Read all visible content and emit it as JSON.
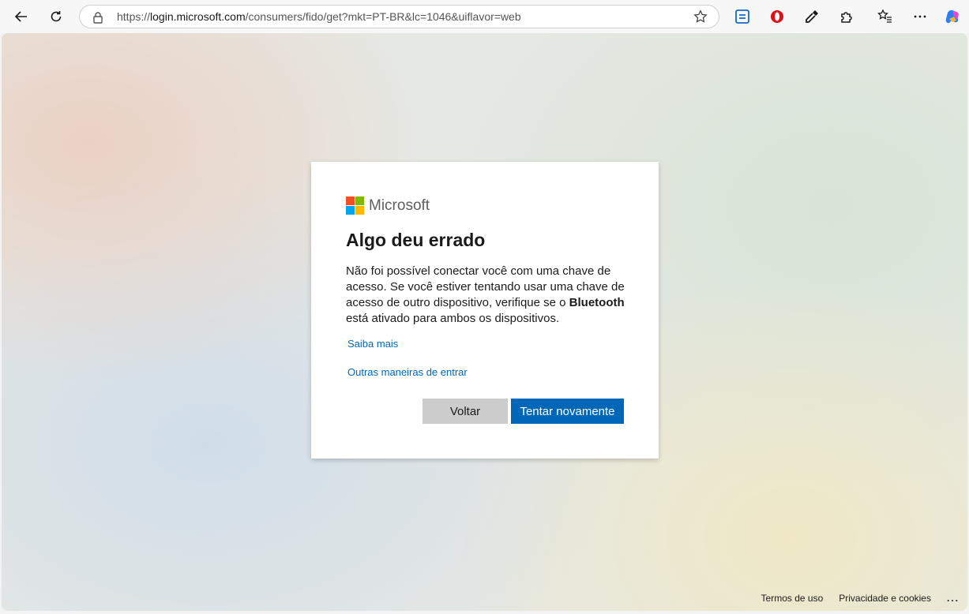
{
  "browser": {
    "url_prefix": "https://",
    "url_host": "login.microsoft.com",
    "url_path": "/consumers/fido/get?mkt=PT-BR&lc=1046&uiflavor=web"
  },
  "card": {
    "brand": "Microsoft",
    "title": "Algo deu errado",
    "description_part1": "Não foi possível conectar você com uma chave de acesso. Se você estiver tentando usar uma chave de acesso de outro dispositivo, verifique se o ",
    "description_bold": "Bluetooth",
    "description_part2": " está ativado para ambos os dispositivos.",
    "learn_more": "Saiba mais",
    "other_ways": "Outras maneiras de entrar",
    "back_label": "Voltar",
    "retry_label": "Tentar novamente"
  },
  "footer": {
    "terms": "Termos de uso",
    "privacy": "Privacidade e cookies",
    "more": "..."
  },
  "colors": {
    "accent": "#0067b8",
    "logo_red": "#f25022",
    "logo_green": "#7fba00",
    "logo_blue": "#00a4ef",
    "logo_yellow": "#ffb900"
  }
}
